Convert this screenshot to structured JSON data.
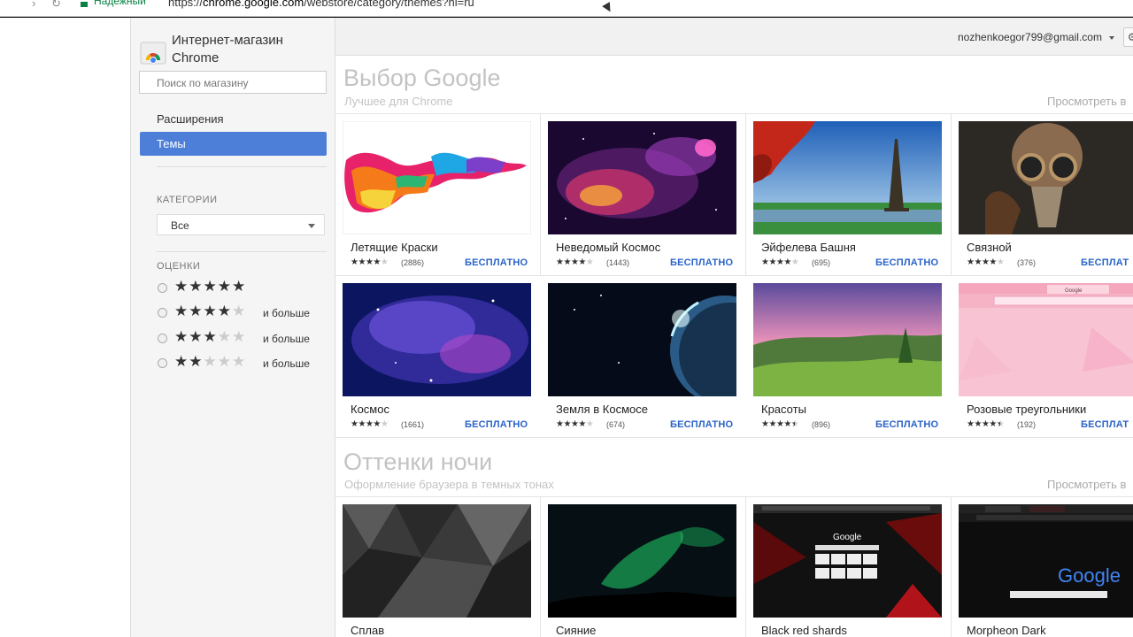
{
  "browser": {
    "secure_label": "Надежный",
    "url_prefix": "https://",
    "url_host": "chrome.google.com",
    "url_path": "/webstore/category/themes?hl=ru"
  },
  "sidebar": {
    "store_title": "Интернет-магазин Chrome",
    "search_placeholder": "Поиск по магазину",
    "nav": [
      {
        "label": "Расширения"
      },
      {
        "label": "Темы"
      }
    ],
    "categories_label": "КАТЕГОРИИ",
    "category_selected": "Все",
    "ratings_label": "ОЦЕНКИ",
    "ratings": [
      {
        "stars": 5,
        "more": ""
      },
      {
        "stars": 4,
        "more": "и больше"
      },
      {
        "stars": 3,
        "more": "и больше"
      },
      {
        "stars": 2,
        "more": "и больше"
      }
    ]
  },
  "account": {
    "email": "nozhenkoegor799@gmail.com"
  },
  "sections": [
    {
      "title": "Выбор Google",
      "subtitle": "Лучшее для Chrome",
      "view_all": "Просмотреть в",
      "themes": [
        {
          "name": "Летящие Краски",
          "count": "(2886)",
          "stars": 4,
          "price": "БЕСПЛАТНО"
        },
        {
          "name": "Неведомый Космос",
          "count": "(1443)",
          "stars": 4,
          "price": "БЕСПЛАТНО"
        },
        {
          "name": "Эйфелева Башня",
          "count": "(695)",
          "stars": 4,
          "price": "БЕСПЛАТНО"
        },
        {
          "name": "Связной",
          "count": "(376)",
          "stars": 4,
          "price": "БЕСПЛАТ"
        },
        {
          "name": "Космос",
          "count": "(1661)",
          "stars": 4,
          "price": "БЕСПЛАТНО"
        },
        {
          "name": "Земля в Космосе",
          "count": "(674)",
          "stars": 4,
          "price": "БЕСПЛАТНО"
        },
        {
          "name": "Красоты",
          "count": "(896)",
          "stars": 4.5,
          "price": "БЕСПЛАТНО"
        },
        {
          "name": "Розовые треугольники",
          "count": "(192)",
          "stars": 4.5,
          "price": "БЕСПЛАТ"
        }
      ]
    },
    {
      "title": "Оттенки ночи",
      "subtitle": "Оформление браузера в темных тонах",
      "view_all": "Просмотреть в",
      "themes": [
        {
          "name": "Сплав"
        },
        {
          "name": "Сияние"
        },
        {
          "name": "Black red shards"
        },
        {
          "name": "Morpheon Dark"
        }
      ]
    }
  ],
  "thumb_text": {
    "google": "Google"
  }
}
